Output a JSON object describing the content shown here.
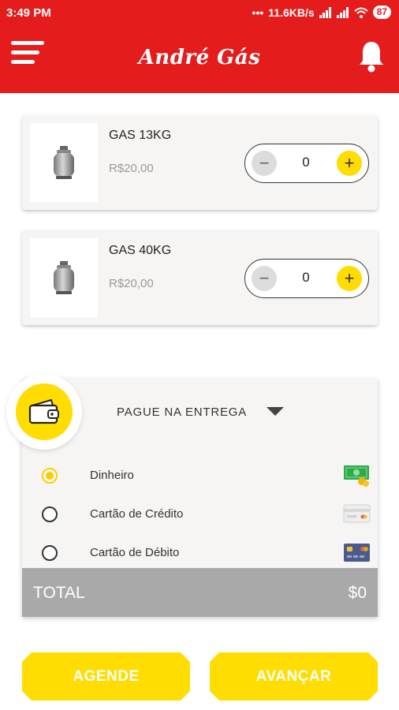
{
  "status_bar": {
    "time": "3:49 PM",
    "network_speed": "11.6KB/s",
    "battery": "87"
  },
  "header": {
    "brand": "André Gás",
    "menu_icon": "hamburger-menu-icon",
    "notification_icon": "bell-icon",
    "background_color": "#e41c1c"
  },
  "products": [
    {
      "name": "GAS 13KG",
      "price": "R$20,00",
      "quantity": "0",
      "icon": "gas-cylinder-icon"
    },
    {
      "name": "GAS 40KG",
      "price": "R$20,00",
      "quantity": "0",
      "icon": "gas-cylinder-icon"
    }
  ],
  "stepper": {
    "minus": "−",
    "plus": "+"
  },
  "payment": {
    "title": "PAGUE NA ENTREGA",
    "wallet_icon": "wallet-icon",
    "options": [
      {
        "label": "Dinheiro",
        "selected": true,
        "icon": "cash-icon"
      },
      {
        "label": "Cartão de Crédito",
        "selected": false,
        "icon": "credit-card-icon"
      },
      {
        "label": "Cartão de Débito",
        "selected": false,
        "icon": "debit-card-icon"
      }
    ]
  },
  "total": {
    "label": "TOTAL",
    "value": "$0"
  },
  "buttons": {
    "schedule": "AGENDE",
    "next": "AVANÇAR"
  },
  "colors": {
    "accent_yellow": "#ffdd00",
    "header_red": "#e41c1c",
    "total_gray": "#a9a9a9"
  }
}
